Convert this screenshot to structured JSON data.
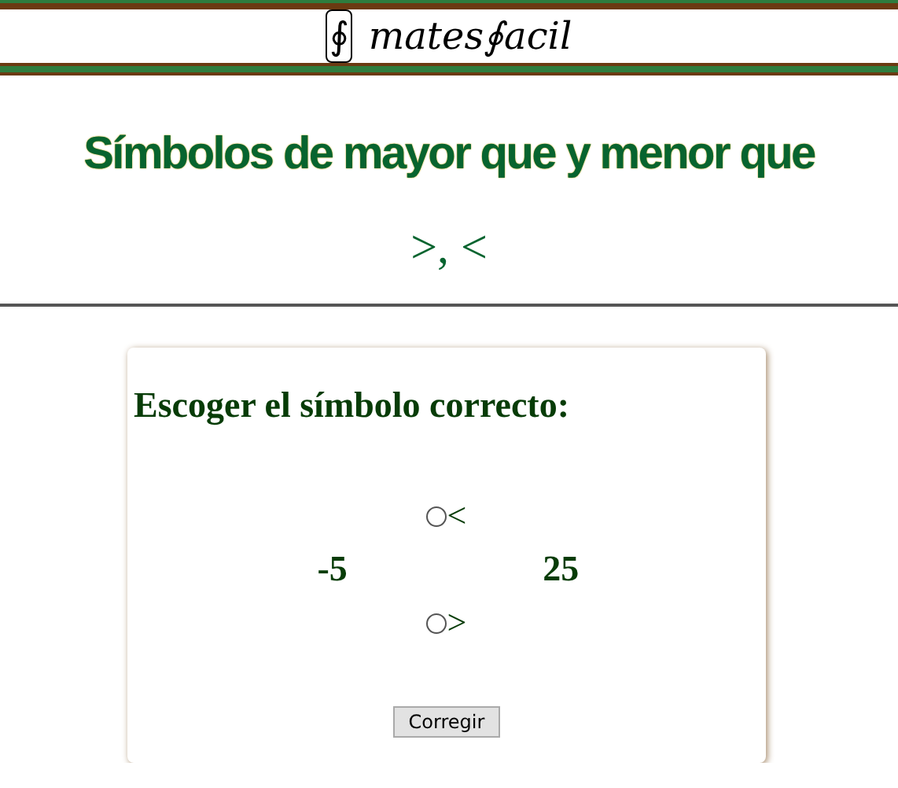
{
  "logo": {
    "icon_glyph": "∮",
    "text": "mates∮acil"
  },
  "title": "Símbolos de mayor que y menor que",
  "subtitle": ">, <",
  "exercise": {
    "prompt": "Escoger el símbolo correcto:",
    "options": [
      {
        "label": "<",
        "selected": false
      },
      {
        "label": ">",
        "selected": false
      }
    ],
    "left_number": "-5",
    "right_number": "25",
    "button": "Corregir"
  }
}
